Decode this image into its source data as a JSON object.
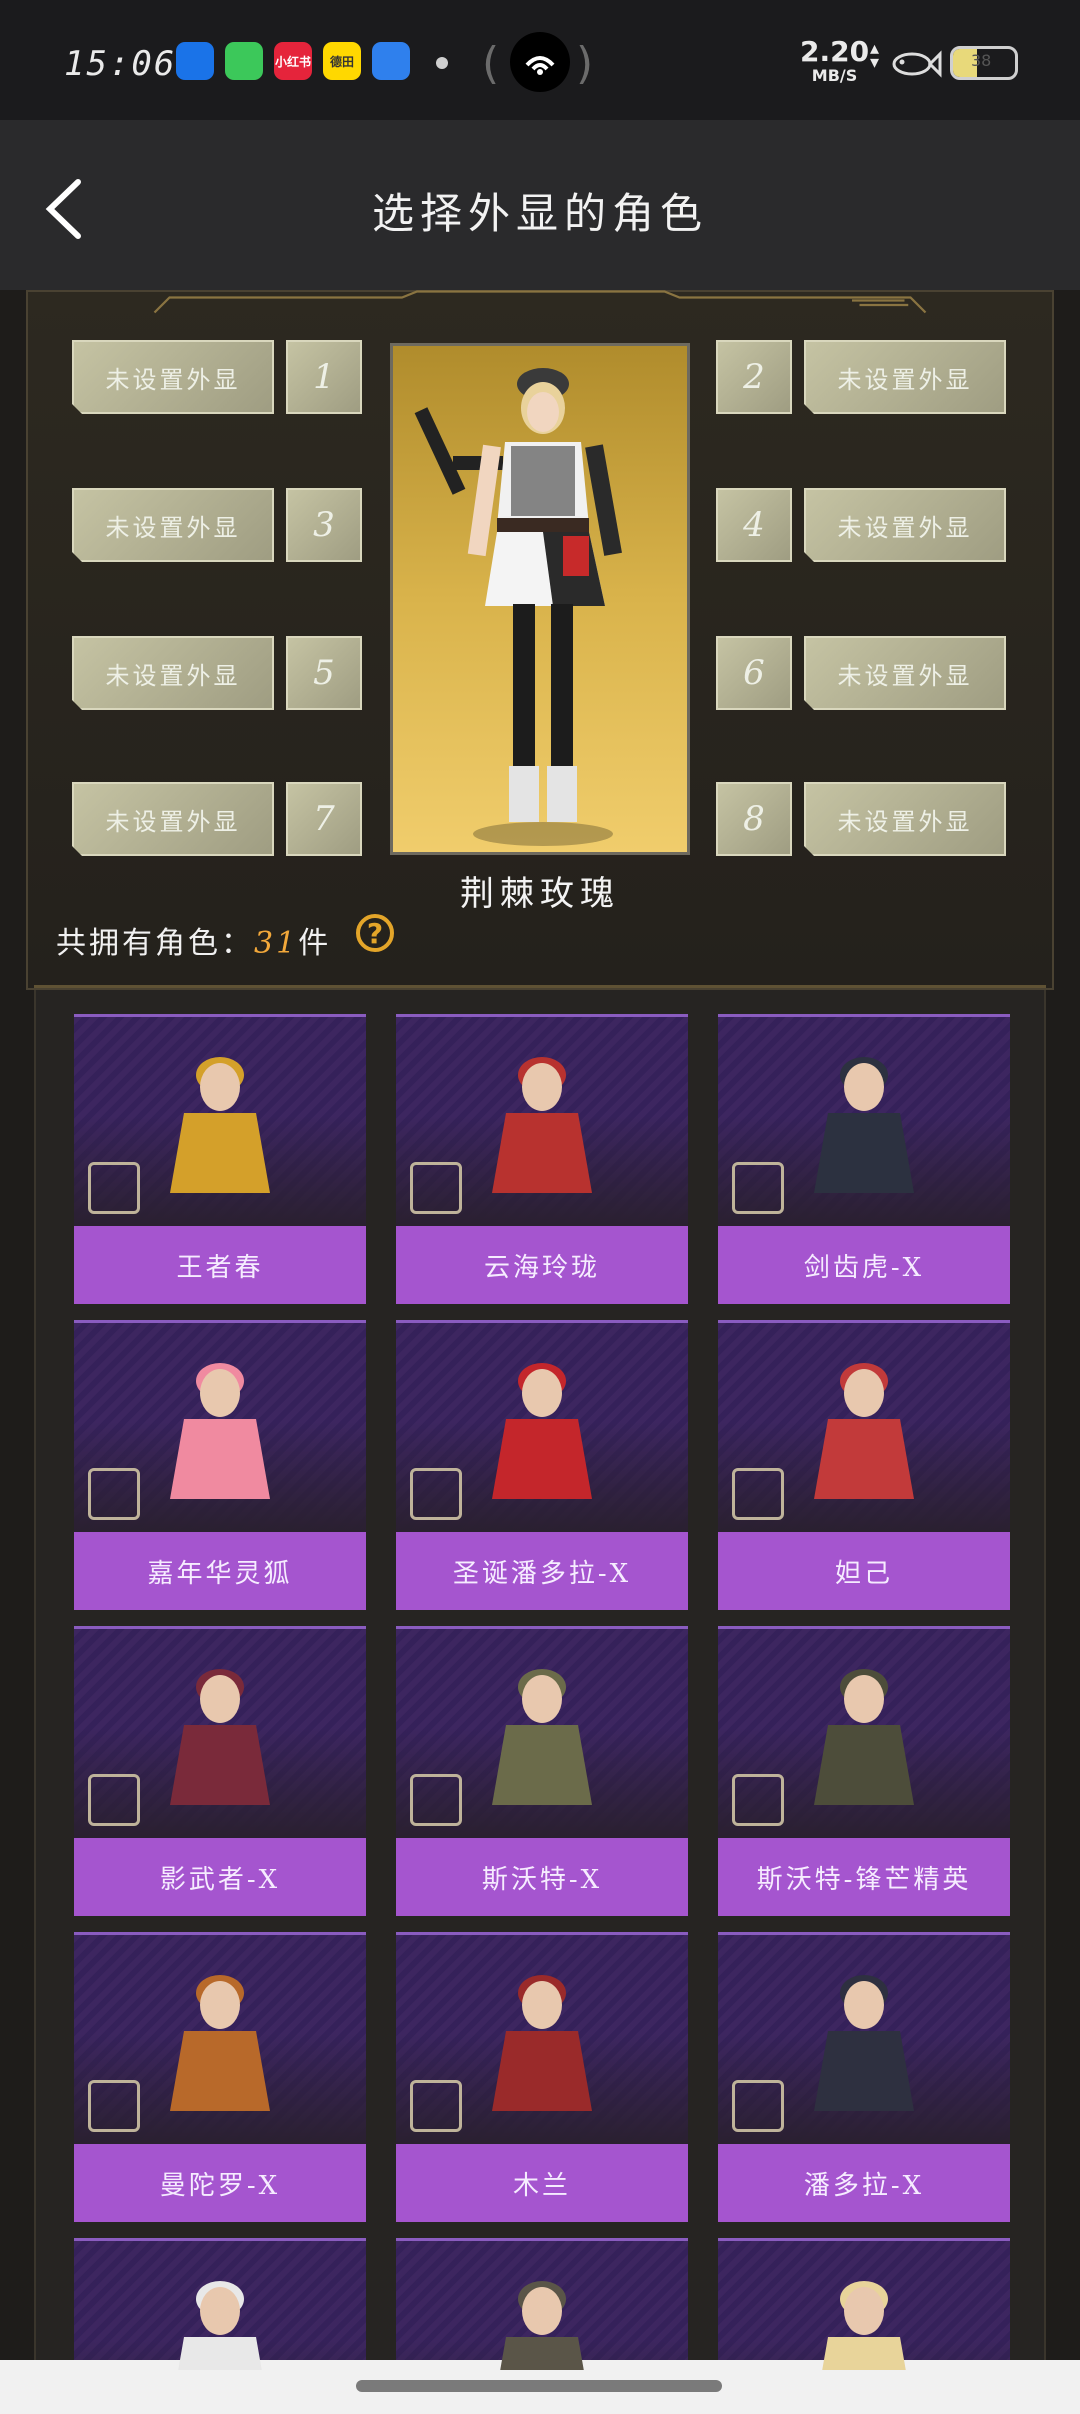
{
  "status_bar": {
    "time": "15:06",
    "net_speed_value": "2.20",
    "net_speed_unit": "MB/S",
    "battery_level": "38",
    "app_icons": [
      {
        "name": "wifi-app-icon",
        "text": "",
        "color": "#1a73e8"
      },
      {
        "name": "messages-app-icon",
        "text": "",
        "color": "#3cc85a"
      },
      {
        "name": "xiaohongshu-app-icon",
        "text": "小红书",
        "color": "#e5243b"
      },
      {
        "name": "meituan-app-icon",
        "text": "德田",
        "color": "#ffd800"
      },
      {
        "name": "browser-app-icon",
        "text": "",
        "color": "#2f80ed"
      }
    ]
  },
  "header": {
    "title": "选择外显的角色"
  },
  "slots": {
    "empty_label": "未设置外显",
    "numbers": [
      "1",
      "2",
      "3",
      "4",
      "5",
      "6",
      "7",
      "8"
    ]
  },
  "hero": {
    "name": "荆棘玫瑰"
  },
  "summary": {
    "prefix": "共拥有角色：",
    "count": "31",
    "suffix": "件",
    "help_glyph": "?"
  },
  "characters": [
    {
      "name": "王者春",
      "accent": "#d4a02a"
    },
    {
      "name": "云海玲珑",
      "accent": "#b8322f"
    },
    {
      "name": "剑齿虎-X",
      "accent": "#2c3140"
    },
    {
      "name": "嘉年华灵狐",
      "accent": "#f08aa0"
    },
    {
      "name": "圣诞潘多拉-X",
      "accent": "#c4262b"
    },
    {
      "name": "妲己",
      "accent": "#c23a3a"
    },
    {
      "name": "影武者-X",
      "accent": "#7a2a3a"
    },
    {
      "name": "斯沃特-X",
      "accent": "#6b6b4a"
    },
    {
      "name": "斯沃特-锋芒精英",
      "accent": "#4d4d3a"
    },
    {
      "name": "曼陀罗-X",
      "accent": "#b8692a"
    },
    {
      "name": "木兰",
      "accent": "#9a2a2a"
    },
    {
      "name": "潘多拉-X",
      "accent": "#2e3040"
    },
    {
      "name": "",
      "accent": "#e8e8e8"
    },
    {
      "name": "",
      "accent": "#5a5548"
    },
    {
      "name": "",
      "accent": "#e8d49a"
    }
  ]
}
